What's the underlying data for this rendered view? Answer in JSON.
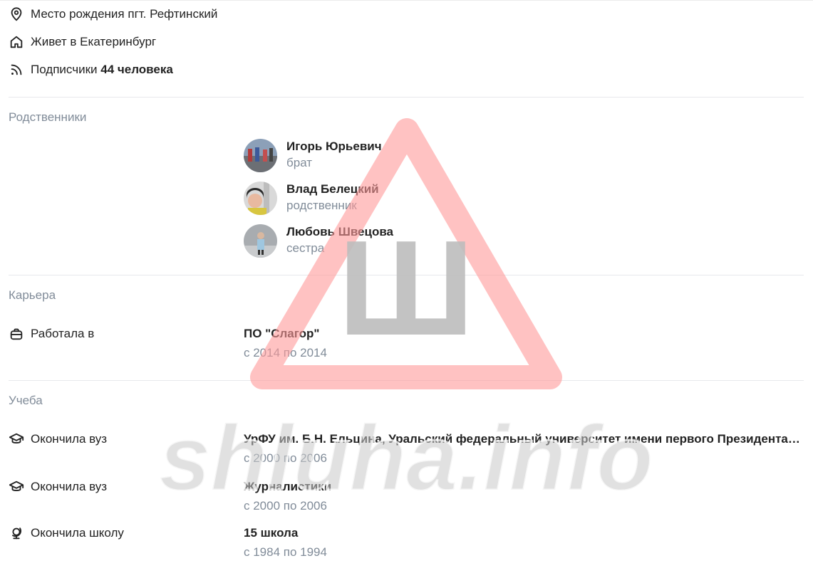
{
  "profile_info": {
    "birthplace_label": "Место рождения пгт. Рефтинский",
    "lives_label": "Живет в Екатеринбург",
    "followers_prefix": "Подписчики",
    "followers_count": "44 человека"
  },
  "relatives": {
    "title": "Родственники",
    "items": [
      {
        "name": "Игорь Юрьевич",
        "role": "брат"
      },
      {
        "name": "Влад Белецкий",
        "role": "родственник"
      },
      {
        "name": "Любовь Швецова",
        "role": "сестра"
      }
    ]
  },
  "career": {
    "title": "Карьера",
    "label": "Работала в",
    "company": "ПО \"Слагор\"",
    "period": "с 2014 по 2014"
  },
  "education": {
    "title": "Учеба",
    "items": [
      {
        "label": "Окончила вуз",
        "name": "УрФУ им. Б.Н. Ельцина, Уральский федеральный университет имени первого Президента России Б.Н. Ельцина",
        "period": "с 2000 по 2006",
        "icon": "graduation-cap-icon"
      },
      {
        "label": "Окончила вуз",
        "name": "Журналистики",
        "period": "с 2000 по 2006",
        "icon": "graduation-cap-icon"
      },
      {
        "label": "Окончила школу",
        "name": "15 школа",
        "period": "с 1984 по 1994",
        "icon": "globe-icon"
      }
    ]
  },
  "watermark": {
    "text": "shluha.info",
    "letter": "Ш",
    "triangle_color": "#ff9999",
    "letter_color": "#bdbdbd",
    "text_color": "#c8c8c8"
  },
  "colors": {
    "secondary_text": "#818c99",
    "primary_text": "#222222",
    "divider": "#e7e8ec"
  }
}
